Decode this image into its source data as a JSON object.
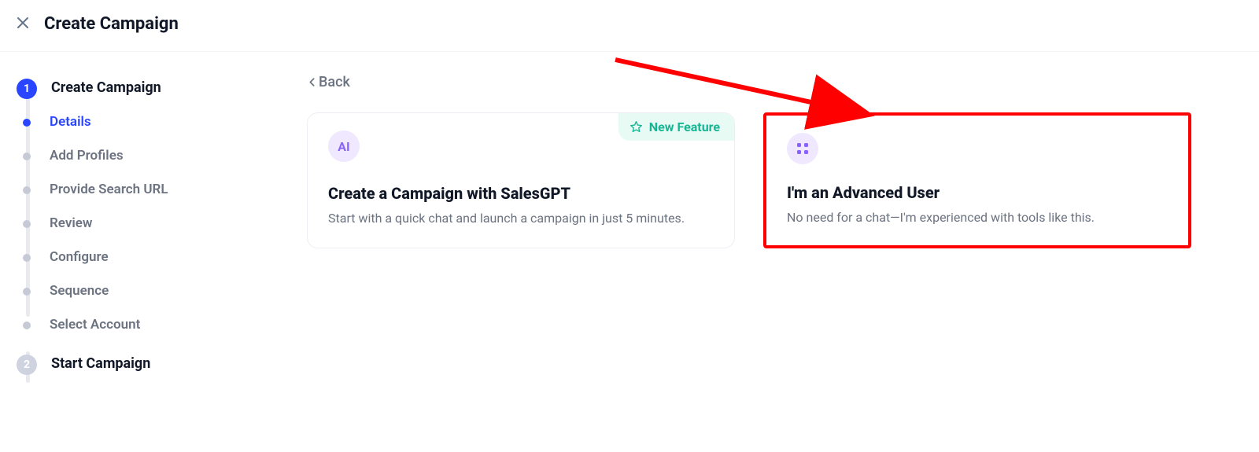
{
  "header": {
    "title": "Create Campaign"
  },
  "sidebar": {
    "step1": {
      "number": "1",
      "label": "Create Campaign"
    },
    "substeps": [
      "Details",
      "Add Profiles",
      "Provide Search URL",
      "Review",
      "Configure",
      "Sequence",
      "Select Account"
    ],
    "step2": {
      "number": "2",
      "label": "Start Campaign"
    }
  },
  "main": {
    "back": "Back",
    "new_feature": "New Feature",
    "card1": {
      "icon_text": "AI",
      "title": "Create a Campaign with SalesGPT",
      "desc": "Start with a quick chat and launch a campaign in just 5 minutes."
    },
    "card2": {
      "title": "I'm an Advanced User",
      "desc": "No need for a chat—I'm experienced with tools like this."
    }
  }
}
